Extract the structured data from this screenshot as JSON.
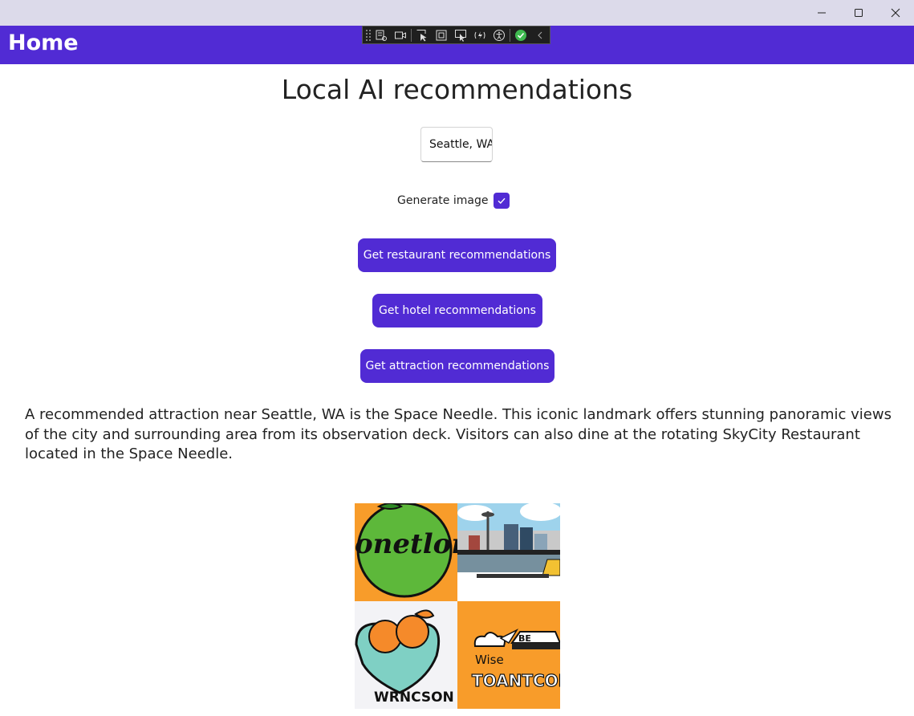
{
  "window": {
    "minimize_icon": "minimize-icon",
    "maximize_icon": "maximize-icon",
    "close_icon": "close-icon"
  },
  "navbar": {
    "title": "Home"
  },
  "debug_toolbar": {
    "icons": [
      "live-visual-tree-icon",
      "video-icon",
      "select-element-icon",
      "display-adorners-icon",
      "track-focus-icon",
      "hot-reload-icon",
      "accessibility-icon",
      "check-icon",
      "collapse-icon"
    ]
  },
  "main": {
    "title": "Local AI recommendations",
    "city_entry": {
      "value": "Seattle, WA"
    },
    "generate_image": {
      "label": "Generate image",
      "checked": true
    },
    "buttons": {
      "restaurant": "Get restaurant recommendations",
      "hotel": "Get hotel recommendations",
      "attraction": "Get attraction recommendations"
    },
    "answer": "A recommended attraction near Seattle, WA is the Space Needle. This iconic landmark offers stunning panoramic views of the city and surrounding area from its observation deck. Visitors can also dine at the rotating SkyCity Restaurant located in the Space Needle.",
    "image": {
      "tile_texts": [
        "onetlone",
        "WRNCSON",
        "BE",
        "Wise",
        "TOANTCON"
      ]
    }
  },
  "colors": {
    "accent": "#512bd4",
    "titlebar": "#dcdaea",
    "orange": "#f89c2a"
  }
}
